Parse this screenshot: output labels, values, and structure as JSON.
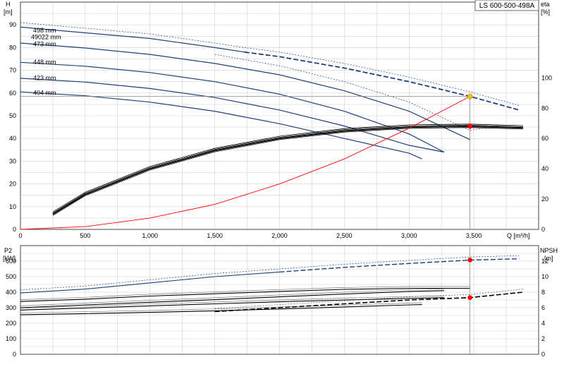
{
  "chart_data": [
    {
      "type": "line",
      "title": "LS 600-500-498A",
      "xlabel": "Q [m³/h]",
      "ylabel": "H [m]",
      "y2label": "eta [%]",
      "xlim": [
        0,
        4000
      ],
      "ylim": [
        0,
        100
      ],
      "y2lim": [
        0,
        150
      ],
      "x_ticks": [
        "0",
        "500",
        "1,000",
        "1,500",
        "2,000",
        "2,500",
        "3,000",
        "3,500"
      ],
      "y_ticks": [
        "0",
        "10",
        "20",
        "30",
        "40",
        "50",
        "60",
        "70",
        "80",
        "90"
      ],
      "y2_ticks": [
        "0",
        "20",
        "40",
        "60",
        "80",
        "100"
      ],
      "grid": true,
      "series": [
        {
          "name": "498 mm",
          "kind": "H",
          "x": [
            0,
            500,
            1000,
            1500,
            1730,
            2000,
            2500,
            3000,
            3470,
            3850
          ],
          "y": [
            89,
            86.5,
            84,
            80,
            78,
            76,
            71,
            65,
            58.5,
            52.5
          ]
        },
        {
          "name": "473 mm",
          "kind": "H",
          "x": [
            0,
            500,
            1000,
            1500,
            2000,
            2500,
            3000,
            3470
          ],
          "y": [
            82,
            79.8,
            77,
            73,
            68,
            61,
            52,
            39.5
          ]
        },
        {
          "name": "448 mm",
          "kind": "H",
          "x": [
            0,
            500,
            1000,
            1500,
            2000,
            2500,
            3000,
            3270
          ],
          "y": [
            73.5,
            71.8,
            69,
            65,
            59.5,
            52,
            42,
            34
          ]
        },
        {
          "name": "423 mm",
          "kind": "H",
          "x": [
            0,
            500,
            1000,
            1500,
            2000,
            2500,
            3000,
            3270
          ],
          "y": [
            66.5,
            64.8,
            62,
            58,
            52.5,
            45.5,
            37,
            34
          ]
        },
        {
          "name": "404 mm",
          "kind": "H",
          "x": [
            0,
            500,
            1000,
            1500,
            2000,
            2500,
            3000,
            3100
          ],
          "y": [
            60.5,
            58.8,
            56,
            52,
            46.5,
            40,
            33.5,
            31
          ]
        },
        {
          "kind": "eta",
          "x": [
            250,
            500,
            1000,
            1500,
            2000,
            2500,
            3000,
            3470,
            3880
          ],
          "y": [
            10,
            23,
            40,
            52,
            60,
            65,
            67.5,
            68,
            67
          ]
        },
        {
          "kind": "system",
          "x": [
            0,
            500,
            1000,
            1500,
            2000,
            2500,
            3000,
            3470
          ],
          "y": [
            0,
            1.2,
            5,
            11,
            20,
            31,
            44.5,
            58.5
          ]
        }
      ],
      "duty_point": {
        "Q": 3470,
        "H": 58.5,
        "eta": 68
      },
      "curve_labels": [
        "498 mm",
        "49022 mm",
        "473 mm",
        "448 mm",
        "423 mm",
        "404 mm"
      ],
      "colors": {
        "curve": "#1f3f7a",
        "eta": "#000000",
        "system": "#ff0000",
        "duty_head": "#ffc000",
        "duty_eta": "#ff0000",
        "grid": "#d0d0d0",
        "ref_line": "#888888"
      }
    },
    {
      "type": "line",
      "title": "",
      "xlabel": "",
      "ylabel": "P2 [kW]",
      "y2label": "NPSH [m]",
      "xlim": [
        0,
        4000
      ],
      "ylim": [
        0,
        700
      ],
      "y2lim": [
        0,
        14
      ],
      "y_ticks": [
        "0",
        "100",
        "200",
        "300",
        "400",
        "500",
        "600"
      ],
      "y2_ticks": [
        "0",
        "2",
        "4",
        "6",
        "8",
        "10",
        "12"
      ],
      "grid": true,
      "series": [
        {
          "name": "498 mm",
          "kind": "P2",
          "x": [
            0,
            500,
            1000,
            1500,
            2000,
            2500,
            3000,
            3470,
            3850
          ],
          "y": [
            395,
            420,
            460,
            500,
            530,
            560,
            585,
            607,
            615
          ]
        },
        {
          "name": "473 mm",
          "kind": "P2",
          "x": [
            0,
            500,
            1000,
            1500,
            2000,
            2500,
            3000,
            3470
          ],
          "y": [
            340,
            355,
            375,
            390,
            405,
            418,
            425,
            425
          ]
        },
        {
          "name": "448 mm",
          "kind": "P2",
          "x": [
            0,
            500,
            1000,
            1500,
            2000,
            2500,
            3000,
            3270
          ],
          "y": [
            300,
            318,
            335,
            352,
            370,
            388,
            405,
            410
          ]
        },
        {
          "name": "423 mm",
          "kind": "P2",
          "x": [
            0,
            500,
            1000,
            1500,
            2000,
            2500,
            3000,
            3270
          ],
          "y": [
            285,
            298,
            312,
            325,
            338,
            350,
            360,
            365
          ]
        },
        {
          "name": "404 mm",
          "kind": "P2",
          "x": [
            0,
            500,
            1000,
            1500,
            2000,
            2500,
            3000,
            3100
          ],
          "y": [
            255,
            262,
            270,
            280,
            292,
            305,
            318,
            320
          ]
        },
        {
          "kind": "NPSH",
          "x": [
            1500,
            2000,
            2500,
            3000,
            3470,
            3880
          ],
          "y": [
            5.5,
            6,
            6.5,
            7,
            7.3,
            8
          ]
        }
      ],
      "duty_point": {
        "Q": 3470,
        "P2": 607,
        "NPSH": 7.3
      },
      "colors": {
        "curve": "#1f3f7a",
        "npsh": "#000000",
        "duty": "#ff0000",
        "grid": "#d0d0d0",
        "ref_line": "#888888"
      }
    }
  ]
}
